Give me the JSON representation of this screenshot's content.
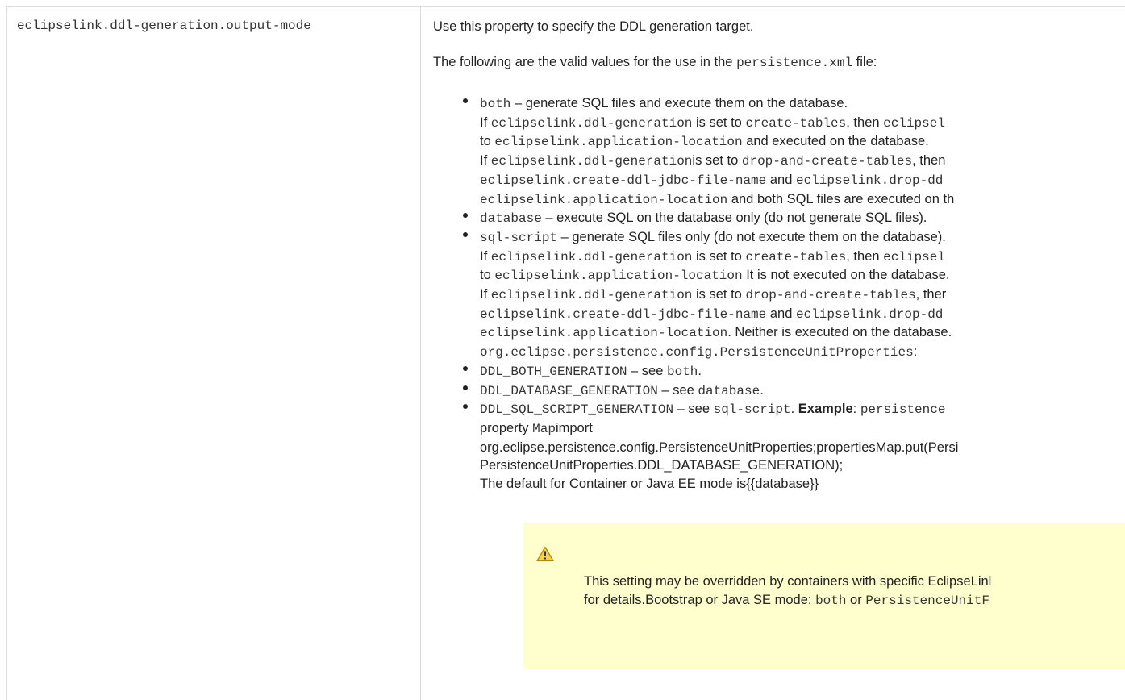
{
  "property": "eclipselink.ddl-generation.output-mode",
  "intro": "Use this property to specify the DDL generation target.",
  "valid_values": {
    "before": "The following are the valid values for the use in the ",
    "code": "persistence.xml",
    "after": " file:"
  },
  "items": [
    {
      "bullet": true,
      "parts": [
        {
          "t": "both",
          "m": true
        },
        {
          "t": " – generate SQL files and execute them on the database."
        }
      ]
    },
    {
      "bullet": false,
      "parts": [
        {
          "t": "If "
        },
        {
          "t": "eclipselink.ddl-generation",
          "m": true
        },
        {
          "t": " is set to "
        },
        {
          "t": "create-tables",
          "m": true
        },
        {
          "t": ", then "
        },
        {
          "t": "eclipsel",
          "m": true
        }
      ]
    },
    {
      "bullet": false,
      "parts": [
        {
          "t": "to "
        },
        {
          "t": "eclipselink.application-location",
          "m": true
        },
        {
          "t": " and executed on the database."
        }
      ]
    },
    {
      "bullet": false,
      "parts": [
        {
          "t": "If "
        },
        {
          "t": "eclipselink.ddl-generation",
          "m": true
        },
        {
          "t": "is set to "
        },
        {
          "t": "drop-and-create-tables",
          "m": true
        },
        {
          "t": ", then"
        }
      ]
    },
    {
      "bullet": false,
      "parts": [
        {
          "t": "eclipselink.create-ddl-jdbc-file-name",
          "m": true
        },
        {
          "t": " and "
        },
        {
          "t": "eclipselink.drop-dd",
          "m": true
        }
      ]
    },
    {
      "bullet": false,
      "parts": [
        {
          "t": "eclipselink.application-location",
          "m": true
        },
        {
          "t": " and both SQL files are executed on th"
        }
      ]
    },
    {
      "bullet": true,
      "parts": [
        {
          "t": "database",
          "m": true
        },
        {
          "t": " – execute SQL on the database only (do not generate SQL files)."
        }
      ]
    },
    {
      "bullet": true,
      "parts": [
        {
          "t": "sql-script",
          "m": true
        },
        {
          "t": " – generate SQL files only (do not execute them on the database)."
        }
      ]
    },
    {
      "bullet": false,
      "parts": [
        {
          "t": "If "
        },
        {
          "t": "eclipselink.ddl-generation",
          "m": true
        },
        {
          "t": " is set to "
        },
        {
          "t": "create-tables",
          "m": true
        },
        {
          "t": ", then "
        },
        {
          "t": "eclipsel",
          "m": true
        }
      ]
    },
    {
      "bullet": false,
      "parts": [
        {
          "t": "to "
        },
        {
          "t": "eclipselink.application-location",
          "m": true
        },
        {
          "t": " It is not executed on the database."
        }
      ]
    },
    {
      "bullet": false,
      "parts": [
        {
          "t": "If "
        },
        {
          "t": "eclipselink.ddl-generation",
          "m": true
        },
        {
          "t": " is set to "
        },
        {
          "t": "drop-and-create-tables",
          "m": true
        },
        {
          "t": ", ther"
        }
      ]
    },
    {
      "bullet": false,
      "parts": [
        {
          "t": "eclipselink.create-ddl-jdbc-file-name",
          "m": true
        },
        {
          "t": " and "
        },
        {
          "t": "eclipselink.drop-dd",
          "m": true
        }
      ]
    },
    {
      "bullet": false,
      "parts": [
        {
          "t": "eclipselink.application-location",
          "m": true
        },
        {
          "t": ". Neither is executed on the database."
        }
      ]
    },
    {
      "bullet": false,
      "parts": [
        {
          "t": "org.eclipse.persistence.config.PersistenceUnitProperties",
          "m": true
        },
        {
          "t": ":"
        }
      ]
    },
    {
      "bullet": true,
      "parts": [
        {
          "t": "DDL_BOTH_GENERATION",
          "m": true
        },
        {
          "t": " – see "
        },
        {
          "t": "both",
          "m": true
        },
        {
          "t": "."
        }
      ]
    },
    {
      "bullet": true,
      "parts": [
        {
          "t": "DDL_DATABASE_GENERATION",
          "m": true
        },
        {
          "t": " – see "
        },
        {
          "t": "database",
          "m": true
        },
        {
          "t": "."
        }
      ]
    },
    {
      "bullet": true,
      "parts": [
        {
          "t": "DDL_SQL_SCRIPT_GENERATION",
          "m": true
        },
        {
          "t": " – see "
        },
        {
          "t": "sql-script",
          "m": true
        },
        {
          "t": ". "
        },
        {
          "t": "Example",
          "b": true
        },
        {
          "t": ": "
        },
        {
          "t": "persistence",
          "m": true
        }
      ]
    },
    {
      "bullet": false,
      "parts": [
        {
          "t": "property "
        },
        {
          "t": "Map",
          "m": true
        },
        {
          "t": "import"
        }
      ]
    },
    {
      "bullet": false,
      "parts": [
        {
          "t": "org.eclipse.persistence.config.PersistenceUnitProperties;propertiesMap.put(Persi"
        }
      ]
    },
    {
      "bullet": false,
      "parts": [
        {
          "t": "PersistenceUnitProperties.DDL_DATABASE_GENERATION);"
        }
      ]
    },
    {
      "bullet": false,
      "parts": [
        {
          "t": "The default for Container or Java EE mode is{{database}}"
        }
      ]
    }
  ],
  "note": {
    "icon": "warning-icon",
    "line1": "This setting may be overridden by containers with specific EclipseLinl",
    "line2_before": "for details.Bootstrap or Java SE mode: ",
    "line2_code1": "both",
    "line2_mid": " or ",
    "line2_code2": "PersistenceUnitF"
  }
}
